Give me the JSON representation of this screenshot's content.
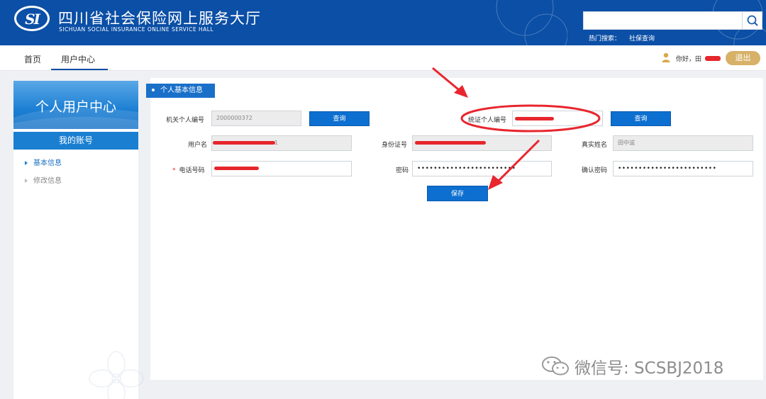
{
  "header": {
    "logo_text": "SI",
    "title": "四川省社会保险网上服务大厅",
    "subtitle": "SICHUAN SOCIAL INSURANCE ONLINE SERVICE HALL",
    "search_placeholder": "",
    "hot_search_label": "热门搜索：",
    "hot_search_link": "社保查询",
    "brand_color": "#0b4fa6"
  },
  "nav": {
    "items": [
      {
        "label": "首页"
      },
      {
        "label": "用户中心"
      }
    ],
    "greeting": "你好，田",
    "logout": "退出"
  },
  "sidebar": {
    "title": "个人用户中心",
    "section": "我的账号",
    "items": [
      {
        "label": "基本信息",
        "active": true
      },
      {
        "label": "修改信息",
        "active": false
      }
    ]
  },
  "panel": {
    "tab": "个人基本信息",
    "fields": {
      "org_person_id_label": "机关个人编号",
      "org_person_id_value": "2000000372",
      "query_btn_1": "查询",
      "unified_person_id_label": "统证个人编号",
      "query_btn_2": "查询",
      "username_label": "用户名",
      "username_value": "1",
      "id_card_label": "身份证号",
      "real_name_label": "真实姓名",
      "real_name_value": "田中诚",
      "phone_label": "电话号码",
      "required_mark": "*",
      "password_label": "密码",
      "password_value": "••••••••••••••••••••••••",
      "confirm_password_label": "确认密码",
      "confirm_password_value": "••••••••••••••••••••••••",
      "save_btn": "保存"
    }
  },
  "watermark": {
    "text": "微信号: SCSBJ2018"
  }
}
